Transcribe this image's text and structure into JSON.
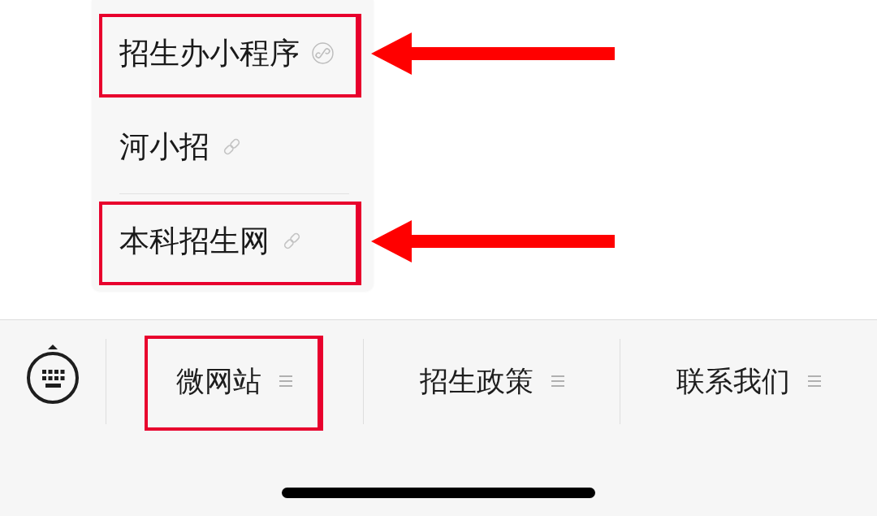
{
  "menu": {
    "items": [
      {
        "label": "招生办小程序",
        "kind": "mini_program",
        "highlighted": true,
        "divider_above": false
      },
      {
        "label": "河小招",
        "kind": "link",
        "highlighted": false,
        "divider_above": false
      },
      {
        "label": "本科招生网",
        "kind": "link",
        "highlighted": true,
        "divider_above": true
      }
    ]
  },
  "tab_bar": {
    "tabs": [
      {
        "label": "微网站",
        "highlighted": true
      },
      {
        "label": "招生政策",
        "highlighted": false
      },
      {
        "label": "联系我们",
        "highlighted": false
      }
    ]
  }
}
